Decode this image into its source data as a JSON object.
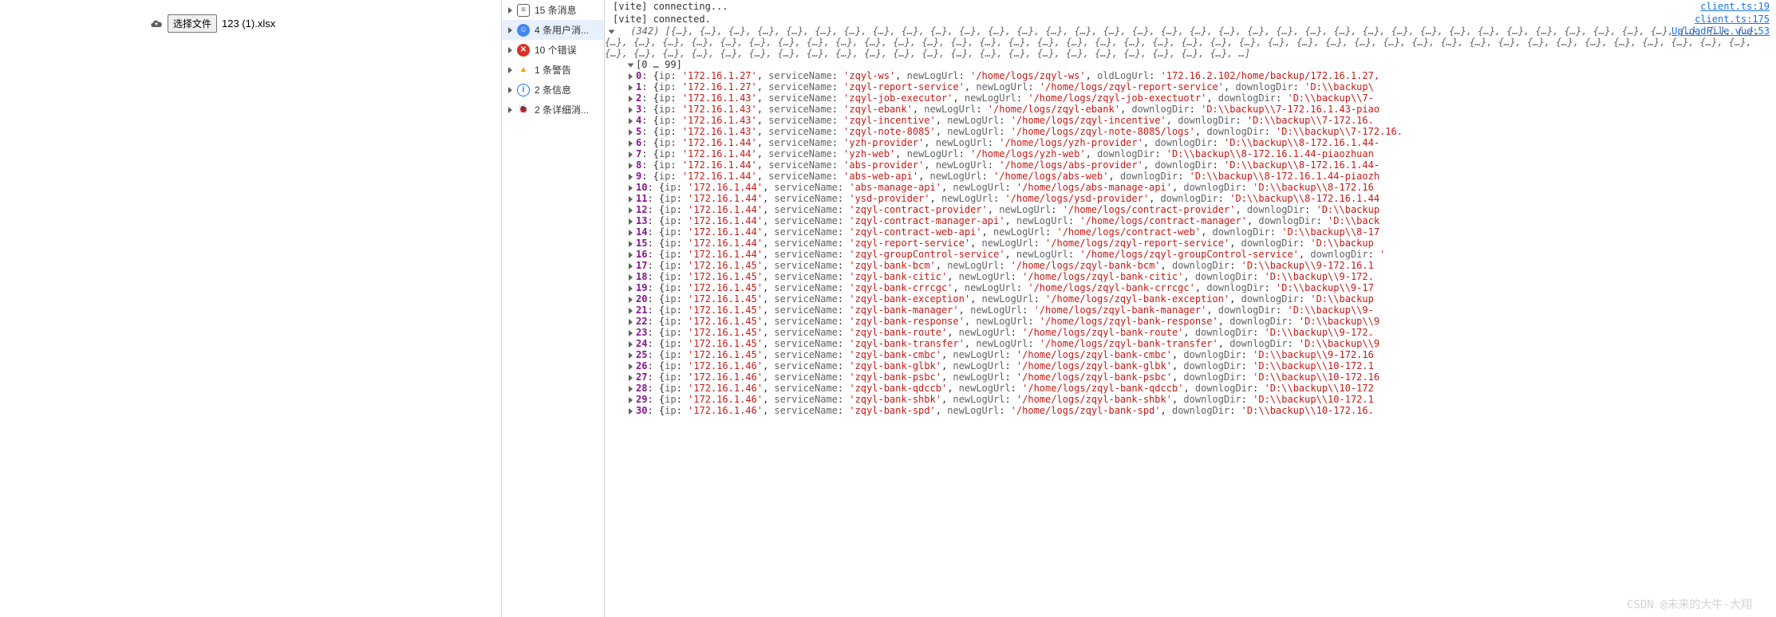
{
  "upload": {
    "button_label": "选择文件",
    "file_name": "123 (1).xlsx"
  },
  "console_filters": [
    {
      "icon": "msg",
      "glyph": "≡",
      "label": "15 条消息",
      "sel": false
    },
    {
      "icon": "user",
      "glyph": "☺",
      "label": "4 条用户消...",
      "sel": true
    },
    {
      "icon": "err",
      "glyph": "✕",
      "label": "10 个错误",
      "sel": false
    },
    {
      "icon": "warn",
      "glyph": "▲",
      "label": "1 条警告",
      "sel": false
    },
    {
      "icon": "info",
      "glyph": "i",
      "label": "2 条信息",
      "sel": false
    },
    {
      "icon": "bug",
      "glyph": "🐞",
      "label": "2 条详细消...",
      "sel": false
    }
  ],
  "console_logs": [
    {
      "text": "[vite] connecting...",
      "src": "client.ts:19"
    },
    {
      "text": "[vite] connected.",
      "src": "client.ts:175"
    }
  ],
  "array_source": "UploadFile.vue:53",
  "array_header": "(342) [{…}, {…}, {…}, {…}, {…}, {…}, {…}, {…}, {…}, {…}, {…}, {…}, {…}, {…}, {…}, {…}, {…}, {…}, {…}, {…}, {…}, {…}, {…}, {…}, {…}, {…}, {…}, {…}, {…}, {…}, {…}, {…}, {…}, {…}, {…}, {…}, {…}, {…}, {…}, {…}, {…}, {…}, {…}, {…}, {…}, {…}, {…}, {…}, {…}, {…}, {…}, {…}, {…}, {…}, {…}, {…}, {…}, {…}, {…}, {…}, {…}, {…}, {…}, {…}, {…}, {…}, {…}, {…}, {…}, {…}, {…}, {…}, {…}, {…}, {…}, {…}, {…}, {…}, {…}, {…}, {…}, {…}, {…}, {…}, {…}, {…}, {…}, {…}, {…}, {…}, {…}, {…}, {…}, {…}, {…}, {…}, {…}, {…}, {…}, {…}, …]",
  "array_range": "[0 … 99]",
  "rows": [
    {
      "idx": 0,
      "ip": "172.16.1.27",
      "serviceName": "zqyl-ws",
      "newLogUrl": "/home/logs/zqyl-ws",
      "oldKey": "oldLogUrl",
      "downArg": "172.16.2.102/home/backup/172.16.1.27,"
    },
    {
      "idx": 1,
      "ip": "172.16.1.27",
      "serviceName": "zqyl-report-service",
      "newLogUrl": "/home/logs/zqyl-report-service",
      "downArg": "D:\\\\backup\\"
    },
    {
      "idx": 2,
      "ip": "172.16.1.43",
      "serviceName": "zqyl-job-executor",
      "newLogUrl": "/home/logs/zqyl-job-exectuotr",
      "downArg": "D:\\\\backup\\\\7-"
    },
    {
      "idx": 3,
      "ip": "172.16.1.43",
      "serviceName": "zqyl-ebank",
      "newLogUrl": "/home/logs/zqyl-ebank",
      "downArg": "D:\\\\backup\\\\7-172.16.1.43-piao"
    },
    {
      "idx": 4,
      "ip": "172.16.1.43",
      "serviceName": "zqyl-incentive",
      "newLogUrl": "/home/logs/zqyl-incentive",
      "downArg": "D:\\\\backup\\\\7-172.16."
    },
    {
      "idx": 5,
      "ip": "172.16.1.43",
      "serviceName": "zqyl-note-8085",
      "newLogUrl": "/home/logs/zqyl-note-8085/logs",
      "downArg": "D:\\\\backup\\\\7-172.16."
    },
    {
      "idx": 6,
      "ip": "172.16.1.44",
      "serviceName": "yzh-provider",
      "newLogUrl": "/home/logs/yzh-provider",
      "downArg": "D:\\\\backup\\\\8-172.16.1.44-"
    },
    {
      "idx": 7,
      "ip": "172.16.1.44",
      "serviceName": "yzh-web",
      "newLogUrl": "/home/logs/yzh-web",
      "downArg": "D:\\\\backup\\\\8-172.16.1.44-piaozhuan"
    },
    {
      "idx": 8,
      "ip": "172.16.1.44",
      "serviceName": "abs-provider",
      "newLogUrl": "/home/logs/abs-provider",
      "downArg": "D:\\\\backup\\\\8-172.16.1.44-"
    },
    {
      "idx": 9,
      "ip": "172.16.1.44",
      "serviceName": "abs-web-api",
      "newLogUrl": "/home/logs/abs-web",
      "downArg": "D:\\\\backup\\\\8-172.16.1.44-piaozh"
    },
    {
      "idx": 10,
      "ip": "172.16.1.44",
      "serviceName": "abs-manage-api",
      "newLogUrl": "/home/logs/abs-manage-api",
      "downArg": "D:\\\\backup\\\\8-172.16"
    },
    {
      "idx": 11,
      "ip": "172.16.1.44",
      "serviceName": "ysd-provider",
      "newLogUrl": "/home/logs/ysd-provider",
      "downArg": "D:\\\\backup\\\\8-172.16.1.44"
    },
    {
      "idx": 12,
      "ip": "172.16.1.44",
      "serviceName": "zqyl-contract-provider",
      "newLogUrl": "/home/logs/contract-provider",
      "downArg": "D:\\\\backup"
    },
    {
      "idx": 13,
      "ip": "172.16.1.44",
      "serviceName": "zqyl-contract-manager-api",
      "newLogUrl": "/home/logs/contract-manager",
      "downArg": "D:\\\\back"
    },
    {
      "idx": 14,
      "ip": "172.16.1.44",
      "serviceName": "zqyl-contract-web-api",
      "newLogUrl": "/home/logs/contract-web",
      "downArg": "D:\\\\backup\\\\8-17"
    },
    {
      "idx": 15,
      "ip": "172.16.1.44",
      "serviceName": "zqyl-report-service",
      "newLogUrl": "/home/logs/zqyl-report-service",
      "downArg": "D:\\\\backup"
    },
    {
      "idx": 16,
      "ip": "172.16.1.44",
      "serviceName": "zqyl-groupControl-service",
      "newLogUrl": "/home/logs/zqyl-groupControl-service",
      "downArg": ""
    },
    {
      "idx": 17,
      "ip": "172.16.1.45",
      "serviceName": "zqyl-bank-bcm",
      "newLogUrl": "/home/logs/zqyl-bank-bcm",
      "downArg": "D:\\\\backup\\\\9-172.16.1"
    },
    {
      "idx": 18,
      "ip": "172.16.1.45",
      "serviceName": "zqyl-bank-citic",
      "newLogUrl": "/home/logs/zqyl-bank-citic",
      "downArg": "D:\\\\backup\\\\9-172."
    },
    {
      "idx": 19,
      "ip": "172.16.1.45",
      "serviceName": "zqyl-bank-crrcgc",
      "newLogUrl": "/home/logs/zqyl-bank-crrcgc",
      "downArg": "D:\\\\backup\\\\9-17"
    },
    {
      "idx": 20,
      "ip": "172.16.1.45",
      "serviceName": "zqyl-bank-exception",
      "newLogUrl": "/home/logs/zqyl-bank-exception",
      "downArg": "D:\\\\backup"
    },
    {
      "idx": 21,
      "ip": "172.16.1.45",
      "serviceName": "zqyl-bank-manager",
      "newLogUrl": "/home/logs/zqyl-bank-manager",
      "downArg": "D:\\\\backup\\\\9-"
    },
    {
      "idx": 22,
      "ip": "172.16.1.45",
      "serviceName": "zqyl-bank-response",
      "newLogUrl": "/home/logs/zqyl-bank-response",
      "downArg": "D:\\\\backup\\\\9"
    },
    {
      "idx": 23,
      "ip": "172.16.1.45",
      "serviceName": "zqyl-bank-route",
      "newLogUrl": "/home/logs/zqyl-bank-route",
      "downArg": "D:\\\\backup\\\\9-172."
    },
    {
      "idx": 24,
      "ip": "172.16.1.45",
      "serviceName": "zqyl-bank-transfer",
      "newLogUrl": "/home/logs/zqyl-bank-transfer",
      "downArg": "D:\\\\backup\\\\9"
    },
    {
      "idx": 25,
      "ip": "172.16.1.45",
      "serviceName": "zqyl-bank-cmbc",
      "newLogUrl": "/home/logs/zqyl-bank-cmbc",
      "downArg": "D:\\\\backup\\\\9-172.16"
    },
    {
      "idx": 26,
      "ip": "172.16.1.46",
      "serviceName": "zqyl-bank-glbk",
      "newLogUrl": "/home/logs/zqyl-bank-glbk",
      "downArg": "D:\\\\backup\\\\10-172.1"
    },
    {
      "idx": 27,
      "ip": "172.16.1.46",
      "serviceName": "zqyl-bank-psbc",
      "newLogUrl": "/home/logs/zqyl-bank-psbc",
      "downArg": "D:\\\\backup\\\\10-172.16"
    },
    {
      "idx": 28,
      "ip": "172.16.1.46",
      "serviceName": "zqyl-bank-qdccb",
      "newLogUrl": "/home/logs/zqyl-bank-qdccb",
      "downArg": "D:\\\\backup\\\\10-172"
    },
    {
      "idx": 29,
      "ip": "172.16.1.46",
      "serviceName": "zqyl-bank-shbk",
      "newLogUrl": "/home/logs/zqyl-bank-shbk",
      "downArg": "D:\\\\backup\\\\10-172.1"
    },
    {
      "idx": 30,
      "ip": "172.16.1.46",
      "serviceName": "zqyl-bank-spd",
      "newLogUrl": "/home/logs/zqyl-bank-spd",
      "downArg": "D:\\\\backup\\\\10-172.16."
    }
  ],
  "watermark": "CSDN @未来的大牛-大翔"
}
